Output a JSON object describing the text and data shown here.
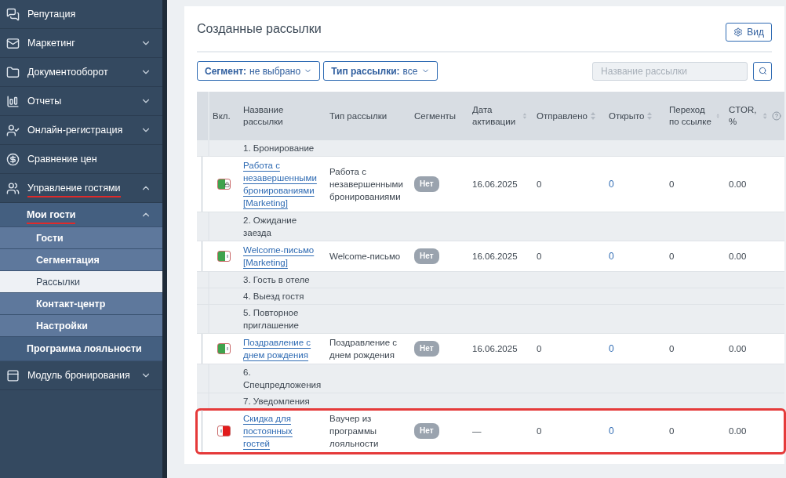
{
  "sidebar": {
    "items": [
      {
        "label": "Репутация",
        "selected": false
      },
      {
        "label": "Маркетинг",
        "expanded": false,
        "selected": false
      },
      {
        "label": "Документооборот",
        "expanded": false,
        "selected": false
      },
      {
        "label": "Отчеты",
        "expanded": false,
        "selected": false
      },
      {
        "label": "Онлайн-регистрация",
        "expanded": false,
        "selected": false
      },
      {
        "label": "Сравнение цен",
        "selected": false
      },
      {
        "label": "Управление гостями",
        "expanded": true,
        "underlined": true,
        "selected": false,
        "children": [
          {
            "label": "Мои гости",
            "expanded": true,
            "underlined": true,
            "selected": false,
            "children": [
              {
                "label": "Гости",
                "selected": false
              },
              {
                "label": "Сегментация",
                "selected": false
              },
              {
                "label": "Рассылки",
                "selected": true
              },
              {
                "label": "Контакт-центр",
                "selected": false
              },
              {
                "label": "Настройки",
                "selected": false
              }
            ]
          },
          {
            "label": "Программа лояльности",
            "selected": false
          }
        ]
      },
      {
        "label": "Модуль бронирования",
        "expanded": false,
        "selected": false
      }
    ]
  },
  "main": {
    "title": "Созданные рассылки",
    "view_button": "Вид",
    "filters": [
      {
        "label": "Сегмент:",
        "value": "не выбрано"
      },
      {
        "label": "Тип рассылки:",
        "value": "все"
      }
    ],
    "search": {
      "placeholder": "Название рассылки"
    },
    "table": {
      "columns": [
        {
          "label": "Вкл.",
          "sortable": false
        },
        {
          "label": "Название рассылки",
          "sortable": false
        },
        {
          "label": "Тип рассылки",
          "sortable": false
        },
        {
          "label": "Сегменты",
          "sortable": false
        },
        {
          "label": "Дата активации",
          "sortable": true
        },
        {
          "label": "Отправлено",
          "sortable": true
        },
        {
          "label": "Открыто",
          "sortable": true
        },
        {
          "label": "Переход по ссылке",
          "sortable": true
        },
        {
          "label": "CTOR, %",
          "sortable": true
        }
      ],
      "rows": [
        {
          "kind": "group",
          "label": "1. Бронирование"
        },
        {
          "kind": "mailing",
          "enabled": true,
          "locked": true,
          "highlighted": false,
          "name": "Работа с незавершенными бронированиями [Marketing]",
          "type": "Работа с незавершенными бронированиями",
          "segments": "Нет",
          "date": "16.06.2025",
          "sent": "0",
          "opened": "0",
          "clicks": "0",
          "ctor": "0.00"
        },
        {
          "kind": "group",
          "label": "2. Ожидание заезда"
        },
        {
          "kind": "mailing",
          "enabled": true,
          "locked": false,
          "highlighted": false,
          "name": "Welcome-письмо [Marketing]",
          "type": "Welcome-письмо",
          "segments": "Нет",
          "date": "16.06.2025",
          "sent": "0",
          "opened": "0",
          "clicks": "0",
          "ctor": "0.00"
        },
        {
          "kind": "group",
          "label": "3. Гость в отеле"
        },
        {
          "kind": "group",
          "label": "4. Выезд гостя"
        },
        {
          "kind": "group",
          "label": "5. Повторное приглашение"
        },
        {
          "kind": "mailing",
          "enabled": true,
          "locked": false,
          "highlighted": false,
          "name": "Поздравление с днем рождения",
          "type": "Поздравление с днем рождения",
          "segments": "Нет",
          "date": "16.06.2025",
          "sent": "0",
          "opened": "0",
          "clicks": "0",
          "ctor": "0.00"
        },
        {
          "kind": "group",
          "label": "6. Спецпредложения"
        },
        {
          "kind": "group",
          "label": "7. Уведомления"
        },
        {
          "kind": "mailing",
          "enabled": false,
          "locked": false,
          "highlighted": true,
          "name": "Скидка для постоянных гостей",
          "type": "Ваучер из программы лояльности",
          "segments": "Нет",
          "date": "—",
          "sent": "0",
          "opened": "0",
          "clicks": "0",
          "ctor": "0.00"
        }
      ]
    }
  }
}
